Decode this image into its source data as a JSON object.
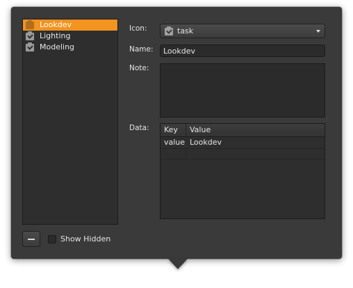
{
  "contexts": {
    "items": [
      {
        "label": "Lookdev",
        "selected": true
      },
      {
        "label": "Lighting",
        "selected": false
      },
      {
        "label": "Modeling",
        "selected": false
      }
    ],
    "show_hidden_label": "Show Hidden",
    "show_hidden_checked": false
  },
  "form": {
    "icon_label": "Icon:",
    "icon_value": "task",
    "name_label": "Name:",
    "name_value": "Lookdev",
    "note_label": "Note:",
    "note_value": "",
    "data_label": "Data:"
  },
  "data_table": {
    "columns": [
      "Key",
      "Value"
    ],
    "rows": [
      {
        "key": "value",
        "value": "Lookdev"
      }
    ]
  },
  "colors": {
    "selection": "#f39320",
    "panel": "#3a3a3a",
    "field": "#2b2b2b"
  },
  "icons": {
    "item_icon": "task-icon",
    "remove_button": "minus-icon",
    "dropdown": "chevron-down-icon"
  }
}
